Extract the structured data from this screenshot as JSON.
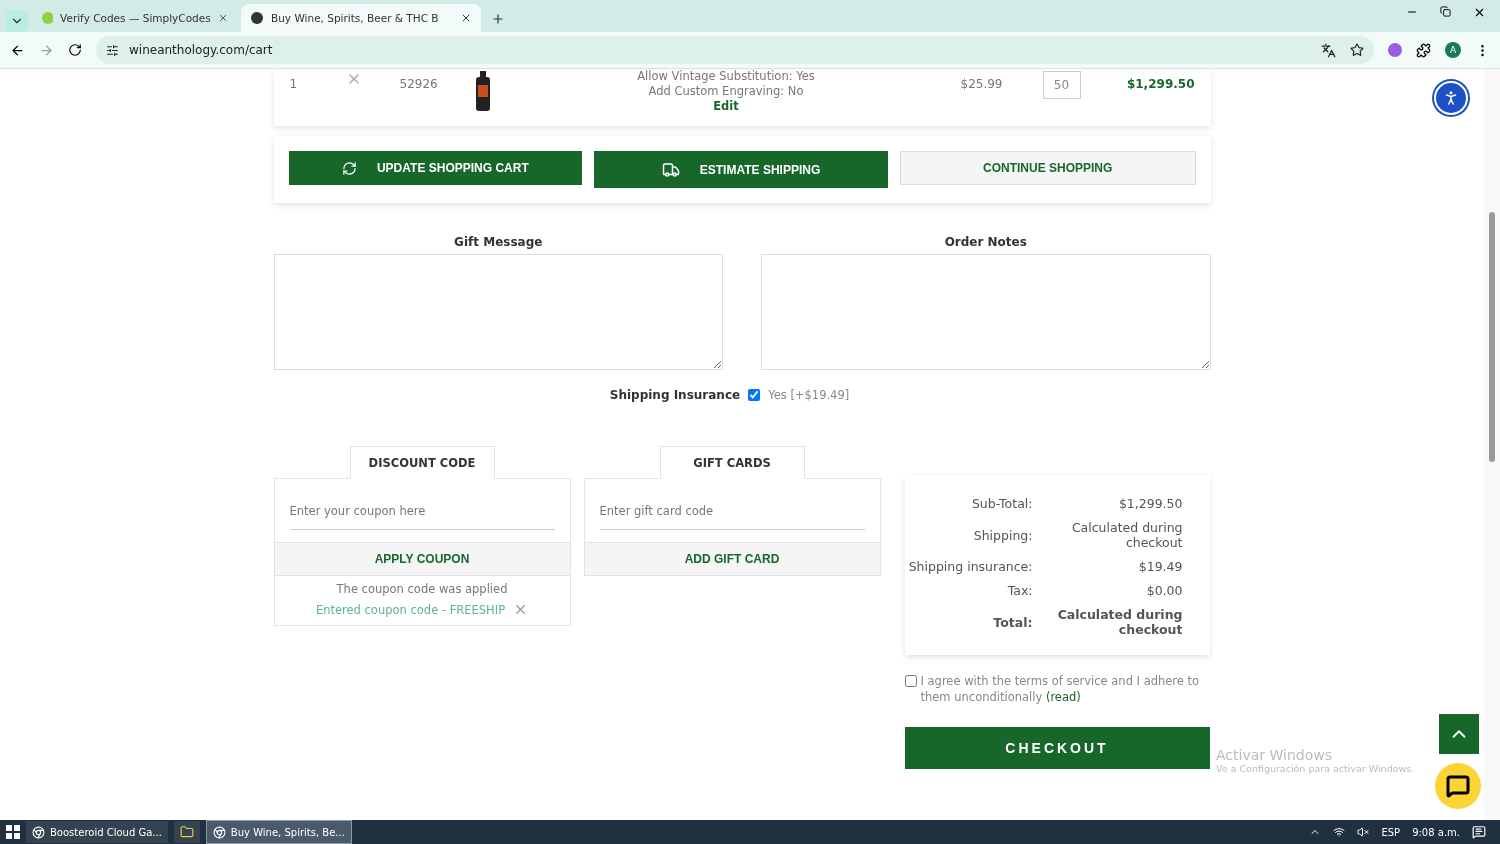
{
  "browser": {
    "tabs": [
      {
        "title": "Verify Codes — SimplyCodes",
        "selected": false
      },
      {
        "title": "Buy Wine, Spirits, Beer & THC B",
        "selected": true
      }
    ],
    "url": "wineanthology.com/cart",
    "profile_initial": "A"
  },
  "cart_item": {
    "index": "1",
    "sku": "52926",
    "options": [
      "Allow Vintage Substitution: Yes",
      "Add Custom Engraving: No"
    ],
    "edit_link": "Edit",
    "price": "$25.99",
    "quantity": "50",
    "total": "$1,299.50"
  },
  "cart_actions": [
    {
      "label": "UPDATE SHOPPING CART",
      "kind": "refresh"
    },
    {
      "label": "ESTIMATE SHIPPING",
      "kind": "truck"
    },
    {
      "label": "CONTINUE SHOPPING",
      "kind": "plain"
    }
  ],
  "notes": [
    {
      "label": "Gift Message"
    },
    {
      "label": "Order Notes"
    }
  ],
  "shipping_insurance": {
    "label": "Shipping Insurance",
    "option": "Yes [+$19.49]",
    "checked": true
  },
  "discount": {
    "tab": "DISCOUNT CODE",
    "placeholder": "Enter your coupon here",
    "button": "APPLY COUPON",
    "status": "The coupon code was applied",
    "applied": "Entered coupon code - FREESHIP"
  },
  "gift_cards": {
    "tab": "GIFT CARDS",
    "placeholder": "Enter gift card code",
    "button": "ADD GIFT CARD"
  },
  "totals": [
    {
      "label": "Sub-Total:",
      "value": "$1,299.50",
      "bold": false
    },
    {
      "label": "Shipping:",
      "value": "Calculated during checkout",
      "bold": false
    },
    {
      "label": "Shipping insurance:",
      "value": "$19.49",
      "bold": false
    },
    {
      "label": "Tax:",
      "value": "$0.00",
      "bold": false
    },
    {
      "label": "Total:",
      "value": "Calculated during checkout",
      "bold": true
    }
  ],
  "terms": {
    "text": "I agree with the terms of service and I adhere to them unconditionally",
    "link": "(read)",
    "checked": false
  },
  "checkout_button": "CHECKOUT",
  "os_notice": {
    "title": "Activar Windows",
    "subtitle": "Ve a Configuración para activar Windows."
  },
  "taskbar": {
    "apps": [
      {
        "title": "Boosteroid Cloud Ga...",
        "kind": "browser",
        "selected": false
      },
      {
        "kind": "folder",
        "selected": false
      },
      {
        "title": "Buy Wine, Spirits, Be...",
        "kind": "browser",
        "selected": true
      }
    ],
    "language": "ESP",
    "time": "9:08 a.m."
  }
}
